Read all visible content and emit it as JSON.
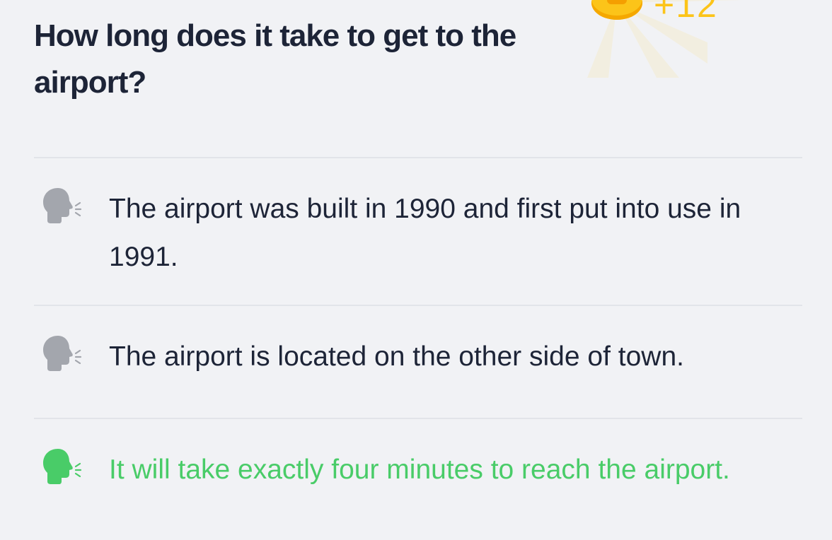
{
  "reward": {
    "amount": "+12",
    "coin_color": "#fcc419"
  },
  "question": {
    "text": "How long does it take to get to the airport?"
  },
  "options": [
    {
      "text": "The airport was built in 1990 and first put into use in 1991.",
      "icon": "speaking-head-icon",
      "state": "default"
    },
    {
      "text": "The airport is located on the other side of town.",
      "icon": "speaking-head-icon",
      "state": "default"
    },
    {
      "text": "It will take exactly four minutes to reach the airport.",
      "icon": "speaking-head-icon",
      "state": "correct"
    }
  ],
  "colors": {
    "background": "#f1f2f5",
    "text": "#1d2437",
    "correct": "#49cc68",
    "icon_default": "#a3a6ad",
    "divider": "#e2e4e9"
  }
}
